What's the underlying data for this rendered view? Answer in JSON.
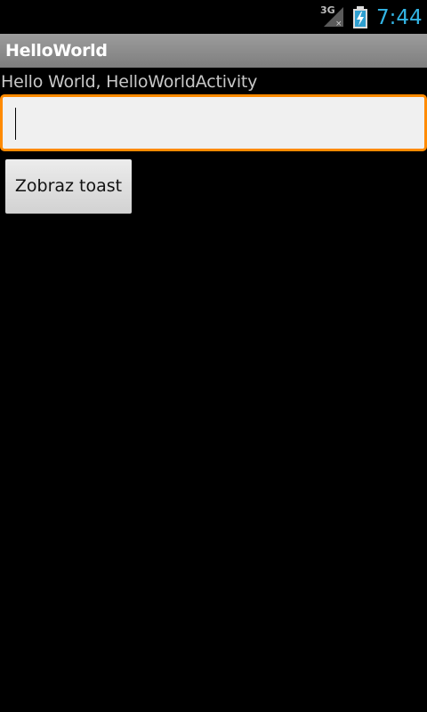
{
  "status_bar": {
    "network_type": "3G",
    "time": "7:44",
    "signal_icon": "signal-no-service-icon",
    "battery_icon": "battery-charging-icon",
    "time_color": "#33b5e5"
  },
  "title_bar": {
    "title": "HelloWorld"
  },
  "main": {
    "hello_text": "Hello World, HelloWorldActivity",
    "input": {
      "value": "",
      "focus_color": "#ff8a00"
    },
    "toast_button_label": "Zobraz toast"
  }
}
